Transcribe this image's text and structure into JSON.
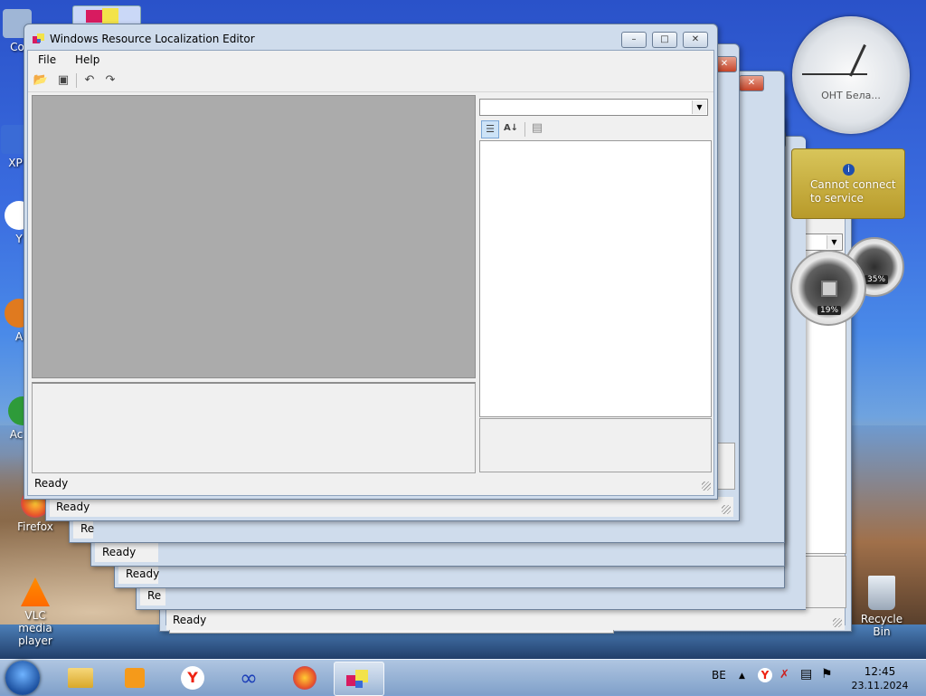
{
  "desktop": {
    "icons": [
      {
        "label": "Co",
        "icon": "computer-icon"
      },
      {
        "label": "XP",
        "icon": "xp-shortcut-icon"
      },
      {
        "label": "Y",
        "icon": "y-shortcut-icon"
      },
      {
        "label": "A",
        "icon": "a-shortcut-icon"
      },
      {
        "label": "Acco",
        "icon": "accounts-shortcut-icon"
      },
      {
        "label": "Firefox",
        "icon": "firefox-icon"
      },
      {
        "label": "VLC media player",
        "icon": "vlc-icon"
      },
      {
        "label": "Recycle Bin",
        "icon": "recycle-bin-icon"
      }
    ]
  },
  "main_window": {
    "title": "Windows Resource Localization Editor",
    "menu": [
      "File",
      "Help"
    ],
    "toolbar": [
      "open-folder-icon",
      "save-icon",
      "undo-icon",
      "redo-icon"
    ],
    "property_toolbar": [
      "categorized-icon",
      "alphabetical-icon",
      "property-pages-icon"
    ],
    "status": "Ready",
    "controls": {
      "minimize": "–",
      "maximize": "□",
      "close": "✕"
    }
  },
  "stacked_windows_status": [
    "Ready",
    "Re",
    "Ready",
    "Ready",
    "Re",
    "Ready"
  ],
  "gadgets": {
    "clock_label": "ОНТ Бела...",
    "weather_message": "Cannot connect to service",
    "cpu_percent": "19%",
    "memory_percent": "35%"
  },
  "taskbar": {
    "items": [
      "explorer-icon",
      "media-player-icon",
      "yandex-icon",
      "infinity-app-icon",
      "firefox-icon",
      "resource-editor-icon"
    ],
    "language": "BE",
    "time": "12:45",
    "date": "23.11.2024"
  },
  "colors": {
    "accent": "#3b6de0",
    "close": "#c7452a",
    "gadget": "#d8c55a"
  }
}
